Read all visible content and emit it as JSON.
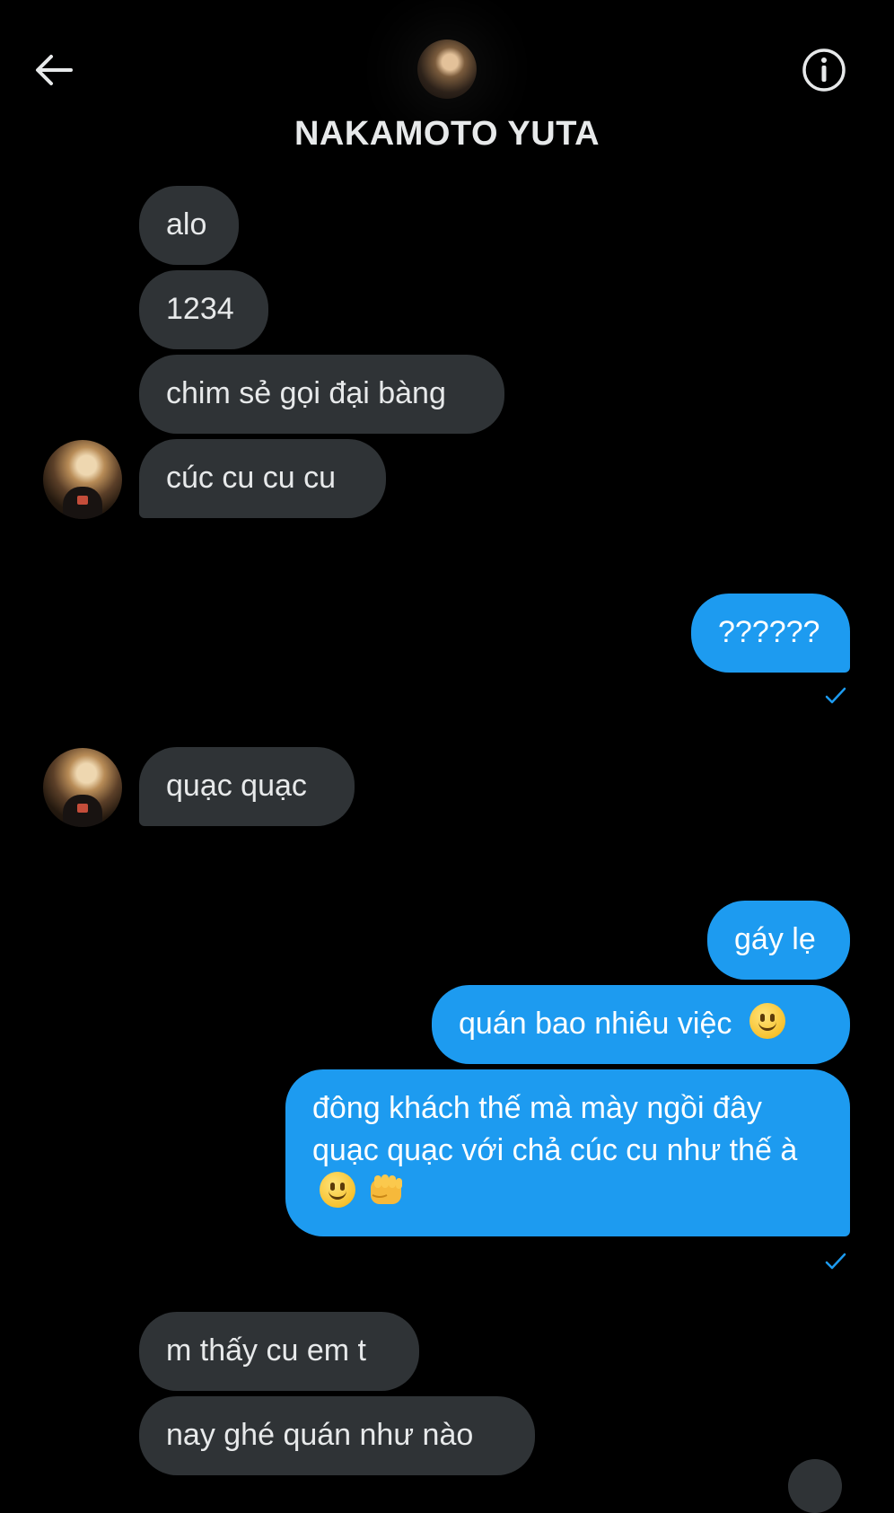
{
  "header": {
    "title": "NAKAMOTO YUTA",
    "back_icon": "arrow-left-icon",
    "info_icon": "info-circle-icon"
  },
  "colors": {
    "background": "#000000",
    "incoming_bubble": "#2f3336",
    "outgoing_bubble": "#1d9bf0",
    "text": "#e7e9ea",
    "check": "#1d9bf0"
  },
  "messages": [
    {
      "side": "in",
      "text": "alo"
    },
    {
      "side": "in",
      "text": "1234"
    },
    {
      "side": "in",
      "text": "chim sẻ gọi đại bàng"
    },
    {
      "side": "in",
      "text": "cúc cu cu cu"
    },
    {
      "side": "out",
      "text": "??????"
    },
    {
      "side": "in",
      "text": "quạc quạc"
    },
    {
      "side": "out",
      "text": "gáy lẹ"
    },
    {
      "side": "out",
      "text": "quán bao nhiêu việc",
      "emoji": [
        "slightly-smiling-face"
      ]
    },
    {
      "side": "out",
      "text": "đông khách thế mà mày ngồi đây quạc quạc với chả cúc cu như thế à",
      "emoji": [
        "slightly-smiling-face",
        "oncoming-fist"
      ]
    },
    {
      "side": "in",
      "text": "m thấy cu em t"
    },
    {
      "side": "in",
      "text": "nay ghé quán như nào"
    }
  ]
}
